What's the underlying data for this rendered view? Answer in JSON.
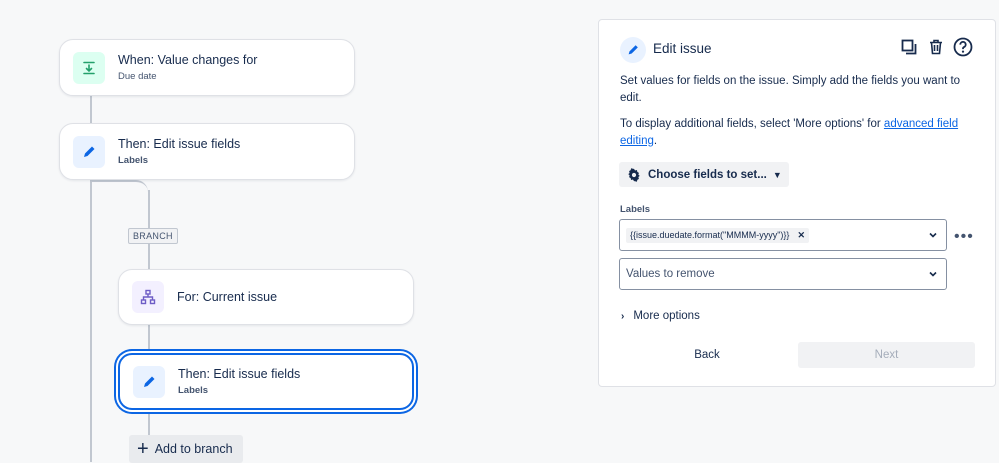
{
  "flow": {
    "trigger": {
      "title": "When: Value changes for",
      "subtitle": "Due date"
    },
    "action1": {
      "title": "Then: Edit issue fields",
      "subtitle": "Labels"
    },
    "branch_tag": "BRANCH",
    "branch_rule": {
      "title": "For: Current issue"
    },
    "action2": {
      "title": "Then: Edit issue fields",
      "subtitle": "Labels"
    },
    "add_branch_label": "Add to branch"
  },
  "panel": {
    "title": "Edit issue",
    "desc1": "Set values for fields on the issue. Simply add the fields you want to edit.",
    "desc2_pre": "To display additional fields, select 'More options' for ",
    "desc2_link": "advanced field editing",
    "desc2_post": ".",
    "choose_fields_label": "Choose fields to set...",
    "labels_field_label": "Labels",
    "labels_chip": "{{issue.duedate.format(\"MMMM-yyyy\")}}",
    "remove_placeholder": "Values to remove",
    "more_options": "More options",
    "back": "Back",
    "next": "Next"
  },
  "colors": {
    "accent": "#0c66e4",
    "trigger_icon": "#22a06b",
    "branch_icon": "#6e5dc6"
  }
}
